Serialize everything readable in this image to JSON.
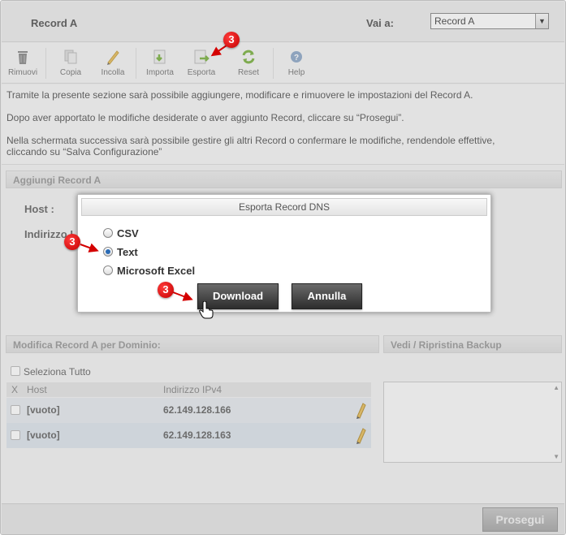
{
  "header": {
    "title": "Record A",
    "goto_label": "Vai a:",
    "goto_value": "Record A"
  },
  "toolbar": {
    "items": [
      {
        "label": "Rimuovi",
        "icon": "trash-icon"
      },
      {
        "label": "Copia",
        "icon": "copy-icon"
      },
      {
        "label": "Incolla",
        "icon": "paste-icon"
      },
      {
        "label": "Importa",
        "icon": "import-icon"
      },
      {
        "label": "Esporta",
        "icon": "export-icon"
      },
      {
        "label": "Reset",
        "icon": "reset-icon"
      },
      {
        "label": "Help",
        "icon": "help-icon"
      }
    ]
  },
  "info": {
    "p1": "Tramite la presente sezione sarà possibile aggiungere, modificare e rimuovere le impostazioni del Record A.",
    "p2": "Dopo aver apportato le modifiche desiderate o aver aggiunto Record, cliccare su “Prosegui”.",
    "p3a": "Nella schermata successiva sarà possibile gestire gli altri Record o confermare le modifiche, rendendole effettive,",
    "p3b": "cliccando su “Salva Configurazione”"
  },
  "add_section": {
    "title": "Aggiungi Record A",
    "host_label": "Host :",
    "ip_label": "Indirizzo I"
  },
  "modify_section": {
    "title": "Modifica Record A per Dominio:",
    "select_all": "Seleziona Tutto",
    "columns": {
      "x": "X",
      "host": "Host",
      "ip": "Indirizzo IPv4"
    },
    "rows": [
      {
        "host": "[vuoto]",
        "ip": "62.149.128.166"
      },
      {
        "host": "[vuoto]",
        "ip": "62.149.128.163"
      }
    ]
  },
  "backup_section": {
    "title": "Vedi / Ripristina Backup"
  },
  "footer": {
    "proceed_label": "Prosegui"
  },
  "dialog": {
    "title": "Esporta Record DNS",
    "options": [
      "CSV",
      "Text",
      "Microsoft Excel"
    ],
    "selected": "Text",
    "download_label": "Download",
    "cancel_label": "Annulla"
  },
  "annotations": {
    "step_badge": "3"
  },
  "colors": {
    "badge": "#d40000",
    "button_dark": "#3a3a3a",
    "radio_selected": "#2a6bb5"
  }
}
